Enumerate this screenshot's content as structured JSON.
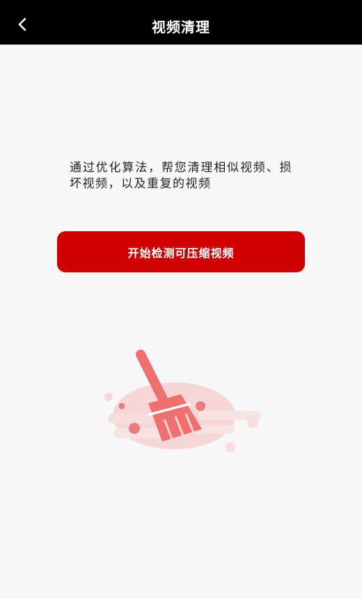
{
  "header": {
    "title": "视频清理"
  },
  "main": {
    "description": "通过优化算法，帮您清理相似视频、损坏视频，以及重复的视频",
    "start_button_label": "开始检测可压缩视频"
  },
  "colors": {
    "header_bg": "#000000",
    "accent": "#d10000",
    "page_bg": "#f7f7f7",
    "illustration_primary": "#f07070",
    "illustration_secondary": "#f6c3c3"
  },
  "icons": {
    "back": "chevron-left-icon",
    "illustration": "broom-icon"
  }
}
